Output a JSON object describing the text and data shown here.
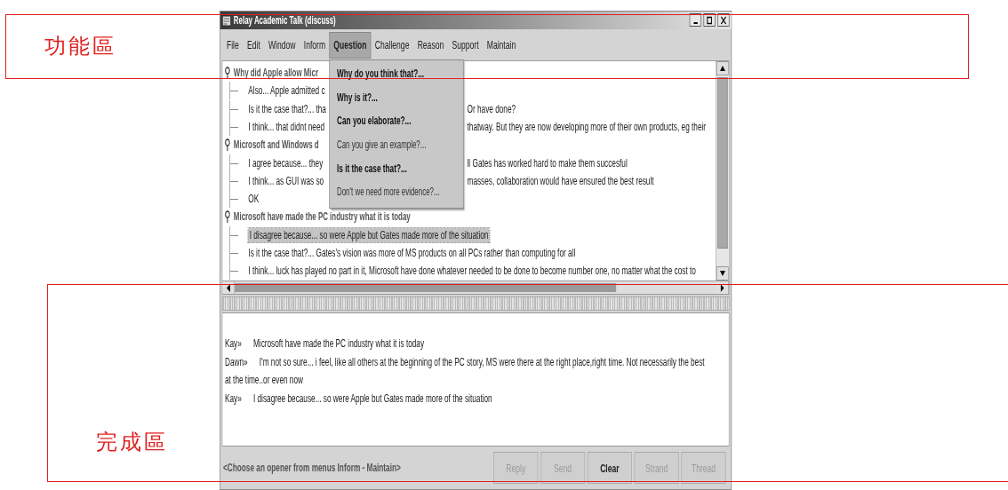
{
  "window": {
    "title": "Relay Academic Talk (discuss)"
  },
  "menu_bar": [
    {
      "label": "File",
      "selected": false
    },
    {
      "label": "Edit",
      "selected": false
    },
    {
      "label": "Window",
      "selected": false
    },
    {
      "label": "Inform",
      "selected": false
    },
    {
      "label": "Question",
      "selected": true
    },
    {
      "label": "Challenge",
      "selected": false
    },
    {
      "label": "Reason",
      "selected": false
    },
    {
      "label": "Support",
      "selected": false
    },
    {
      "label": "Maintain",
      "selected": false
    }
  ],
  "open_menu": {
    "items": [
      {
        "label": "Why do you think that?...",
        "disabled": false
      },
      {
        "label": "Why is it?...",
        "disabled": false
      },
      {
        "label": "Can you elaborate?...",
        "disabled": false
      },
      {
        "label": "Can you give an example?...",
        "disabled": true
      },
      {
        "label": "Is it the case that?...",
        "disabled": false
      },
      {
        "label": "Don't we need more evidence?...",
        "disabled": true
      }
    ]
  },
  "tree": [
    {
      "text": "Why did Apple allow Micr",
      "children": [
        {
          "text": "Also... Apple admitted c",
          "selected": false
        },
        {
          "text": "Is it the case that?... tha",
          "text_after": "Or have done?",
          "selected": false
        },
        {
          "text": "I think... that didnt need",
          "text_after": "thatway. But they are now developing more of their own products, eg their",
          "selected": false
        }
      ]
    },
    {
      "text": "Microsoft and Windows d",
      "children": [
        {
          "text": "I agree because... they",
          "text_after": "ll Gates has worked hard to make them succesful",
          "selected": false
        },
        {
          "text": "I think... as GUI was so",
          "text_after": "masses, collaboration would have ensured the best result",
          "selected": false
        },
        {
          "text": "OK",
          "selected": false
        }
      ]
    },
    {
      "text": "Microsoft have made the PC industry what it is today",
      "children": [
        {
          "text": "I disagree because... so were Apple but Gates made more of the situation",
          "selected": true
        },
        {
          "text": "Is it the case that?... Gates's vision was more of MS products on all PCs rather than computing for all",
          "selected": false
        },
        {
          "text": "I think... luck has played no part in it, Microsoft have done whatever needed to be done to become number one, no matter what the cost to",
          "selected": false
        }
      ]
    }
  ],
  "chat": [
    {
      "speaker": "Kay»",
      "text": "Microsoft have made the PC industry what it is today"
    },
    {
      "speaker": "Dawn»",
      "text": "I'm not so sure... i feel, like all others at the beginning of the PC story, MS were there at the right place,right time. Not necessarily the best at the time..or even now"
    },
    {
      "speaker": "Kay»",
      "text": "I disagree because... so were Apple but Gates made more of the situation"
    }
  ],
  "status": "<Choose an opener from menus Inform - Maintain>",
  "buttons": [
    {
      "label": "Reply",
      "disabled": true
    },
    {
      "label": "Send",
      "disabled": true
    },
    {
      "label": "Clear",
      "disabled": false
    },
    {
      "label": "Strand",
      "disabled": true
    },
    {
      "label": "Thread",
      "disabled": true
    }
  ],
  "annotations": [
    {
      "label": "功能區"
    },
    {
      "label": "完成區"
    }
  ]
}
